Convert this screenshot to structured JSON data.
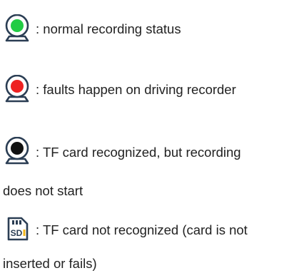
{
  "legend": {
    "items": [
      {
        "icon": "green-camera-status-icon",
        "lamp_color": "#22cc44",
        "line1": ": normal recording status",
        "line2": ""
      },
      {
        "icon": "red-camera-status-icon",
        "lamp_color": "#ee2222",
        "line1": ": faults happen on driving recorder",
        "line2": ""
      },
      {
        "icon": "black-camera-status-icon",
        "lamp_color": "#111111",
        "line1": ": TF card recognized, but recording",
        "line2": "does not start"
      },
      {
        "icon": "sd-card-icon",
        "accent_color": "#f2b51a",
        "card_label": "SD",
        "line1": ": TF card not recognized (card is not",
        "line2": "inserted or fails)"
      }
    ]
  },
  "colors": {
    "icon_outline": "#2b3e54",
    "text": "#222222"
  }
}
